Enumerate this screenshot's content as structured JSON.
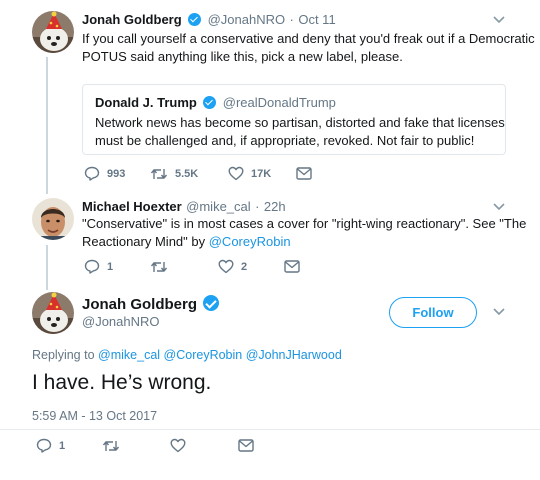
{
  "tweet1": {
    "name": "Jonah Goldberg",
    "handle": "@JonahNRO",
    "sep": "·",
    "date": "Oct 11",
    "text_line1": "If you call yourself a conservative and deny that you'd freak out if a Democratic",
    "text_line2": "POTUS said anything like this, pick a new label, please.",
    "quote": {
      "name": "Donald J. Trump",
      "handle": "@realDonaldTrump",
      "text_line1": "Network news has become so partisan, distorted and fake that licenses",
      "text_line2": "must be challenged and, if appropriate, revoked. Not fair to public!"
    },
    "actions": {
      "replies": "993",
      "retweets": "5.5K",
      "likes": "17K"
    }
  },
  "tweet2": {
    "name": "Michael Hoexter",
    "handle": "@mike_cal",
    "sep": "·",
    "date": "22h",
    "text_line1": "\"Conservative\" is in most cases a cover for \"right-wing reactionary\". See \"The",
    "text_line2_pre": "Reactionary Mind\" by ",
    "text_line2_link": "@CoreyRobin",
    "actions": {
      "replies": "1",
      "retweets": "",
      "likes": "2"
    }
  },
  "main_tweet": {
    "name": "Jonah Goldberg",
    "handle": "@JonahNRO",
    "follow_label": "Follow",
    "replying_label": "Replying to",
    "replying_to": [
      "@mike_cal",
      "@CoreyRobin",
      "@JohnJHarwood"
    ],
    "text": "I have. He’s wrong.",
    "timestamp": "5:59 AM - 13 Oct 2017",
    "actions": {
      "replies": "1"
    }
  },
  "colors": {
    "accent": "#1da1f2",
    "link": "#1b95e0",
    "muted": "#657786",
    "text": "#14171a",
    "thread_line": "#ccd6dd"
  },
  "icons": [
    "chevron-down-icon",
    "verified-badge-icon",
    "reply-icon",
    "retweet-icon",
    "like-icon",
    "dm-icon"
  ]
}
